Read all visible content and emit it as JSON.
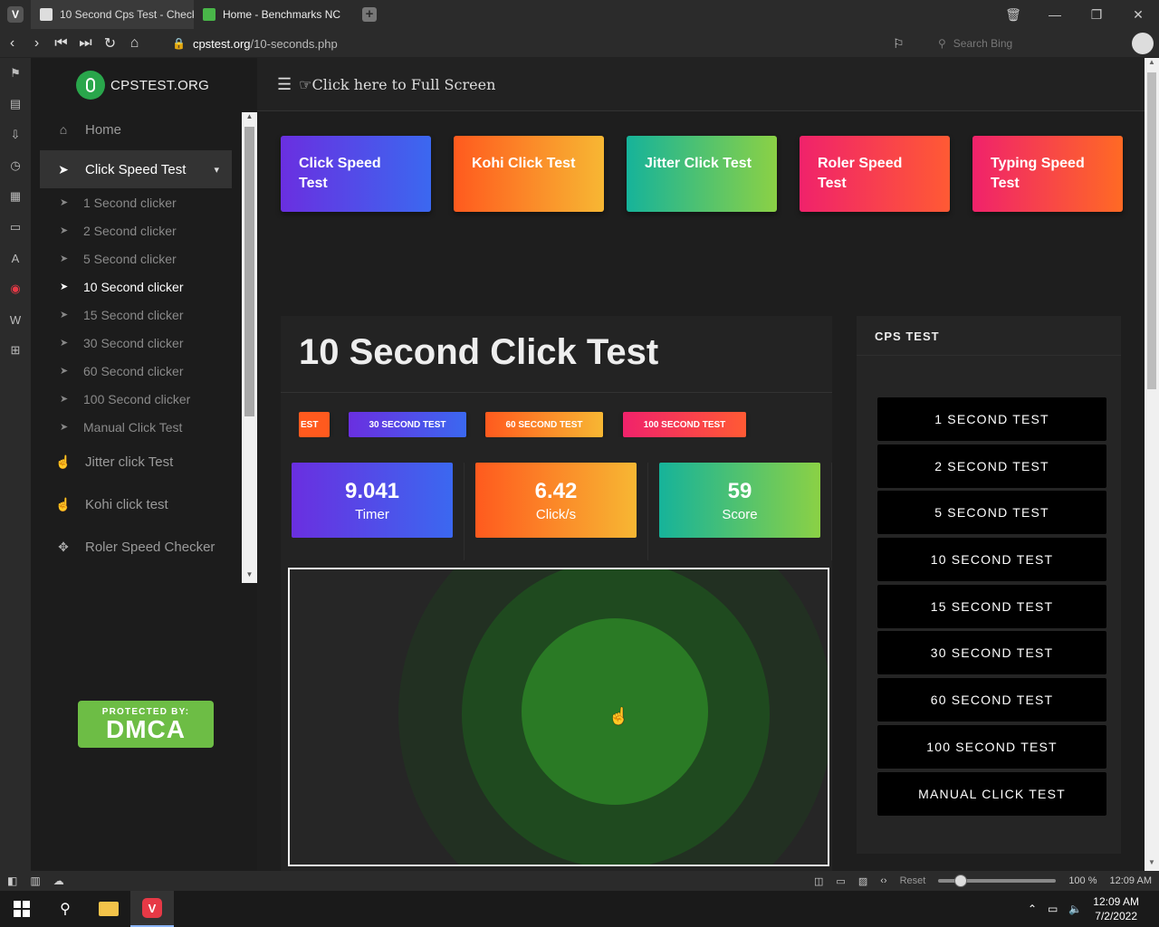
{
  "browser": {
    "tabs": [
      {
        "title": "10 Second Cps Test - Check",
        "active": true
      },
      {
        "title": "Home - Benchmarks NC",
        "active": false
      }
    ],
    "url_domain": "cpstest.org",
    "url_path": "/10-seconds.php",
    "search_placeholder": "Search Bing"
  },
  "site": {
    "logo_text": "CPSTEST.ORG",
    "menu": {
      "home": "Home",
      "click_speed_test": "Click Speed Test",
      "sub_items": [
        "1 Second clicker",
        "2 Second clicker",
        "5 Second clicker",
        "10 Second clicker",
        "15 Second clicker",
        "30 Second clicker",
        "60 Second clicker",
        "100 Second clicker",
        "Manual Click Test"
      ],
      "jitter": "Jitter click Test",
      "kohi": "Kohi click test",
      "roler": "Roler Speed Checker"
    },
    "dmca": {
      "protected_by": "PROTECTED BY:",
      "label": "DMCA"
    }
  },
  "main": {
    "fullscreen_label": "Click here to Full Screen",
    "cards": [
      "Click Speed Test",
      "Kohi Click Test",
      "Jitter Click Test",
      "Roler Speed Test",
      "Typing Speed Test"
    ],
    "title": "10 Second Click Test",
    "pills": [
      "EST",
      "30 SECOND TEST",
      "60 SECOND TEST",
      "100 SECOND TEST"
    ],
    "stats": {
      "timer": {
        "value": "9.041",
        "label": "Timer"
      },
      "cps": {
        "value": "6.42",
        "label": "Click/s"
      },
      "score": {
        "value": "59",
        "label": "Score"
      }
    },
    "cps_panel": {
      "heading": "CPS TEST",
      "buttons": [
        "1 SECOND TEST",
        "2 SECOND TEST",
        "5 SECOND TEST",
        "10 SECOND TEST",
        "15 SECOND TEST",
        "30 SECOND TEST",
        "60 SECOND TEST",
        "100 SECOND TEST",
        "MANUAL CLICK TEST"
      ]
    }
  },
  "statusbar": {
    "reset": "Reset",
    "zoom": "100 %",
    "time": "12:09 AM"
  },
  "taskbar": {
    "time": "12:09 AM",
    "date": "7/2/2022"
  }
}
